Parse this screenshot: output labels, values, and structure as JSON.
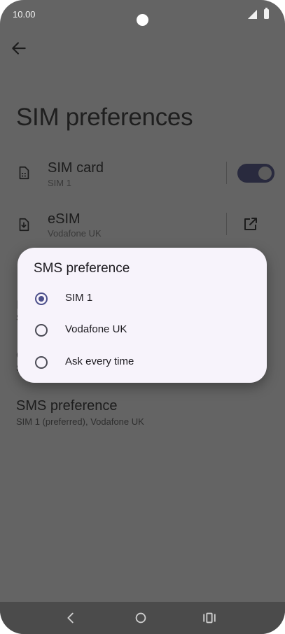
{
  "status_bar": {
    "time": "10.00"
  },
  "page": {
    "title": "SIM preferences"
  },
  "rows": {
    "sim_card": {
      "title": "SIM card",
      "subtitle": "SIM 1",
      "toggle_on": true
    },
    "esim": {
      "title": "eSIM",
      "subtitle": "Vodafone UK"
    }
  },
  "hidden_rows": {
    "row3_title": "I",
    "row3_sub": "S",
    "row4_title": "C",
    "row4_sub": "S"
  },
  "sms_row": {
    "title": "SMS preference",
    "subtitle": "SIM 1 (preferred), Vodafone UK"
  },
  "dialog": {
    "title": "SMS preference",
    "options": [
      {
        "label": "SIM 1",
        "selected": true
      },
      {
        "label": "Vodafone UK",
        "selected": false
      },
      {
        "label": "Ask every time",
        "selected": false
      }
    ]
  },
  "colors": {
    "scrim_bg": "#646464",
    "dialog_bg": "#f7f3fb",
    "accent": "#4c4f8a",
    "toggle_track": "#292a3e"
  },
  "icons": {
    "back": "arrow-left-icon",
    "sim": "sim-card-icon",
    "esim": "esim-download-icon",
    "external": "open-external-icon",
    "nav_back": "chevron-left-icon",
    "nav_home": "circle-home-icon",
    "nav_recents": "recents-icon"
  }
}
